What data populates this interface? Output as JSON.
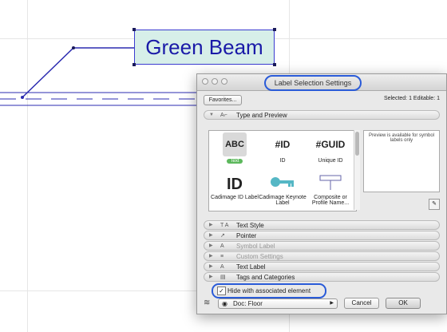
{
  "canvas": {
    "beam_label": "Green Beam"
  },
  "dialog": {
    "title": "Label Selection Settings",
    "favorites_label": "Favorites...",
    "selection_info": "Selected: 1 Editable: 1",
    "type_section": "Type and Preview",
    "label_types": [
      {
        "name": "Text",
        "glyph": "ABC",
        "badge": "Text"
      },
      {
        "name": "ID",
        "glyph": "#ID"
      },
      {
        "name": "Unique ID",
        "glyph": "#GUID"
      },
      {
        "name": "Cadimage ID Label",
        "glyph": "ID"
      },
      {
        "name": "Cadimage Keynote Label",
        "glyph": "key"
      },
      {
        "name": "Composite or Profile Name...",
        "glyph": "composite"
      }
    ],
    "preview_text": "Preview is available for symbol labels only",
    "sections": [
      {
        "label": "Text Style",
        "icon": "T A",
        "dim": false
      },
      {
        "label": "Pointer",
        "icon": "↗",
        "dim": false
      },
      {
        "label": "Symbol Label",
        "icon": "A",
        "dim": true
      },
      {
        "label": "Custom Settings",
        "icon": "≡",
        "dim": true
      },
      {
        "label": "Text Label",
        "icon": "A",
        "dim": false
      },
      {
        "label": "Tags and Categories",
        "icon": "▤",
        "dim": false
      }
    ],
    "hide_checkbox_label": "Hide with associated element",
    "hide_checked": true,
    "layer_value": "Doc: Floor",
    "cancel_label": "Cancel",
    "ok_label": "OK"
  }
}
